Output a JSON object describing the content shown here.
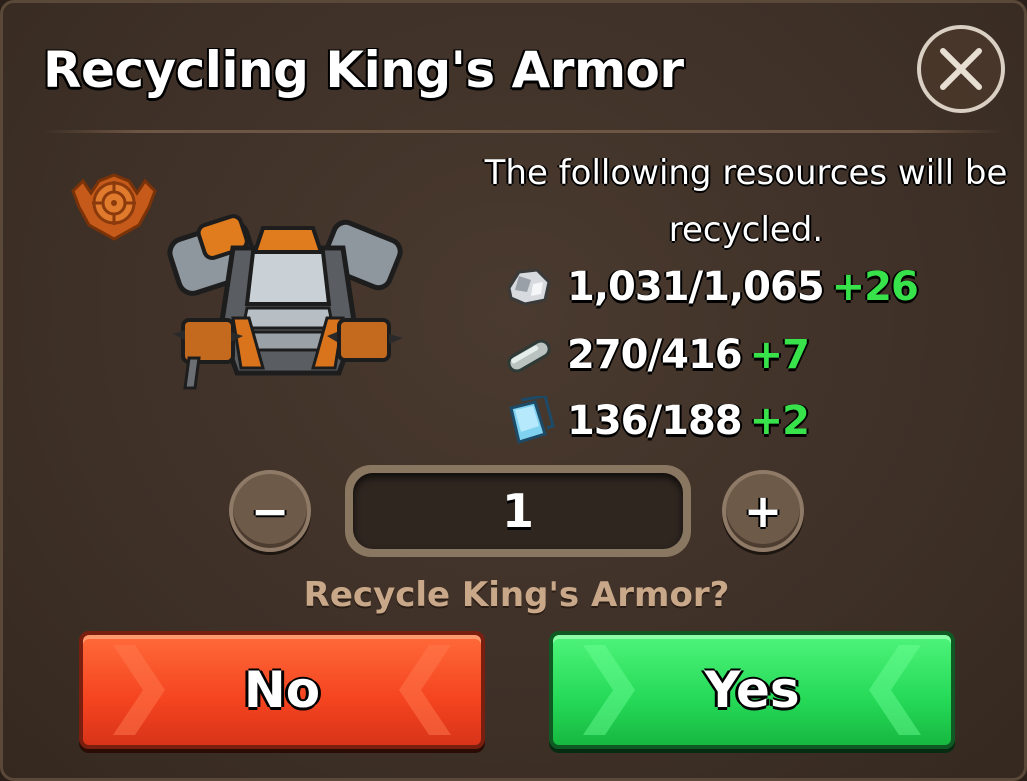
{
  "dialog": {
    "title": "Recycling King's Armor",
    "info_text": "The following resources will be recycled.",
    "question": "Recycle King's Armor?"
  },
  "item": {
    "icon": "kings-armor-chestplate",
    "badge_icon": "target-crest-emblem"
  },
  "resources": [
    {
      "icon": "silver-ore-icon",
      "amount": "1,031/1,065",
      "gain": "+26"
    },
    {
      "icon": "metal-ingot-icon",
      "amount": "270/416",
      "gain": "+7"
    },
    {
      "icon": "crystal-shard-icon",
      "amount": "136/188",
      "gain": "+2"
    }
  ],
  "quantity": {
    "value": "1",
    "decrease_glyph": "−",
    "increase_glyph": "+"
  },
  "buttons": {
    "no_label": "No",
    "yes_label": "Yes"
  },
  "colors": {
    "gain_green": "#38e24a",
    "no_button": "#f4431f",
    "yes_button": "#25d957",
    "question_text": "#c9a88a"
  }
}
